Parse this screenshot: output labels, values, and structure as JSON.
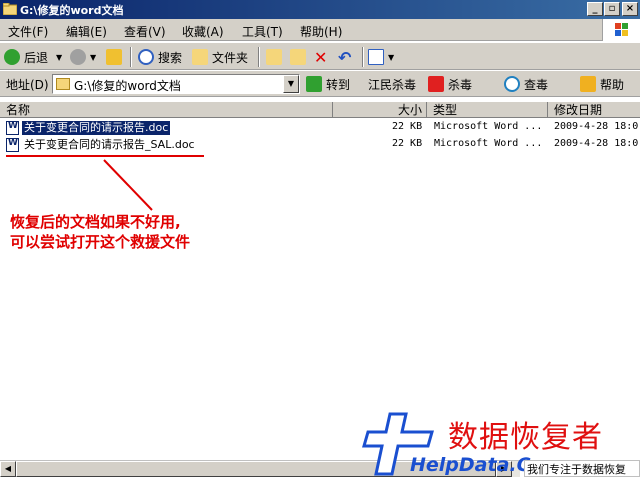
{
  "window": {
    "title": "G:\\修复的word文档"
  },
  "menu": [
    "文件(F)",
    "编辑(E)",
    "查看(V)",
    "收藏(A)",
    "工具(T)",
    "帮助(H)"
  ],
  "toolbar": {
    "back": "后退",
    "search": "搜索",
    "folders": "文件夹"
  },
  "address": {
    "label": "地址(D)",
    "value": "G:\\修复的word文档",
    "go": "转到",
    "antivirus_vendor": "江民杀毒",
    "kill": "杀毒",
    "scan": "查毒",
    "help": "帮助"
  },
  "columns": {
    "name": "名称",
    "size": "大小",
    "type": "类型",
    "modified": "修改日期"
  },
  "files": [
    {
      "name": "关于变更合同的请示报告.doc",
      "size": "22 KB",
      "type": "Microsoft Word ...",
      "modified": "2009-4-28 18:0"
    },
    {
      "name": "关于变更合同的请示报告_SAL.doc",
      "size": "22 KB",
      "type": "Microsoft Word ...",
      "modified": "2009-4-28 18:0"
    }
  ],
  "annotation": {
    "line1": "恢复后的文档如果不好用,",
    "line2": "可以尝试打开这个救援文件"
  },
  "watermark": {
    "brand_cn": "数据恢复者",
    "brand_en": "HelpData.Cn",
    "slogan": "我们专注于数据恢复"
  },
  "colors": {
    "titlebar": "#0a246a",
    "selection": "#0a246a",
    "annotation": "#e00000",
    "watermark_red": "#e01010",
    "watermark_blue": "#1a4fd0"
  }
}
